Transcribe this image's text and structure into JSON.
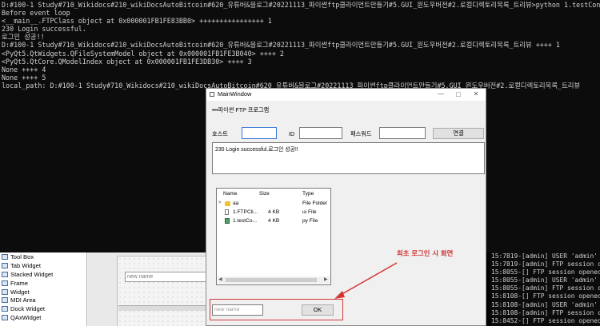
{
  "console": {
    "lines": [
      "D:#100-1 Study#710_Wikidocs#210_wikiDocsAutoBitcoin#620_유튜버&블로그#20221113_파이썬ftp클라이언트만들기#5.GUI_윈도우버전#2.로컬디렉토리목록_트리뷰>python 1.testConnect5.py",
      "Before event loop",
      "<__main__.FTPClass object at 0x000001FB1FE83BB0> ++++++++++++++++ 1",
      "230 Login successful.",
      "로그인 성공!!",
      "D:#100-1 Study#710_Wikidocs#210_wikiDocsAutoBitcoin#620_유튜버&블로그#20221113_파이썬ftp클라이언트만들기#5.GUI_윈도우버전#2.로컬디렉토리목록_트리뷰 ++++ 1",
      "<PyQt5.QtWidgets.QFileSystemModel object at 0x000001FB1FE3B040> ++++ 2",
      "<PyQt5.QtCore.QModelIndex object at 0x000001FB1FE3DB30> ++++ 3",
      "None ++++ 4",
      "None ++++ 5",
      "local_path: D:#100-1 Study#710_Wikidocs#210_wikiDocsAutoBitcoin#620_유튜버&블로그#20221113_파이썬ftp클라이언트만들기#5.GUI_윈도우버전#2.로컬디렉토리목록_트리뷰"
    ]
  },
  "widget_box": {
    "items": [
      "Tool Box",
      "Tab Widget",
      "Stacked Widget",
      "Frame",
      "Widget",
      "MDI Area",
      "Dock Widget",
      "QAxWidget"
    ]
  },
  "designer_canvas": {
    "input_placeholder": "new name"
  },
  "server_log": {
    "lines": [
      "15:7819-[admin] USER 'admin' lo",
      "15:7819-[admin] FTP session clo",
      "15:8055-[] FTP session opened (c",
      "15:8055-[admin] USER 'admin' lo",
      "15:8055-[admin] FTP session clo",
      "15:8108-[] FTP session opened (c",
      "15:8108-[admin] USER 'admin' lo",
      "15:8108-[admin] FTP session clo",
      "15:8452-[] FTP session opened (c"
    ]
  },
  "window": {
    "title": "MainWindow",
    "minimize_symbol": "—",
    "maximize_symbol": "□",
    "close_symbol": "✕",
    "program_label": "•••파이썬 FTP 프로그램",
    "host_label": "호스트",
    "host_value": "",
    "id_label": "ID",
    "id_value": "",
    "password_label": "패스워드",
    "password_value": "",
    "connect_button": "연결",
    "log_text": "230 Login successful.로그인 성공!!",
    "tree": {
      "headers": {
        "name": "Name",
        "size": "Size",
        "type": "Type"
      },
      "rows": [
        {
          "name": "aa",
          "size": "",
          "type": "File Folder",
          "icon": "folder-icon",
          "expandable": true
        },
        {
          "name": "1.FTPCli...",
          "size": "4 KB",
          "type": "ui File",
          "icon": "file-icon",
          "expandable": false
        },
        {
          "name": "1.testCo...",
          "size": "4 KB",
          "type": "py File",
          "icon": "python-file-icon",
          "expandable": false
        }
      ],
      "scroll_left": "◀",
      "scroll_right": "▶",
      "expander_symbol": ">"
    },
    "name_placeholder": "new name",
    "ok_button": "OK"
  },
  "annotation": {
    "text": "최초 로그인 시 화면",
    "color": "#d23434"
  }
}
